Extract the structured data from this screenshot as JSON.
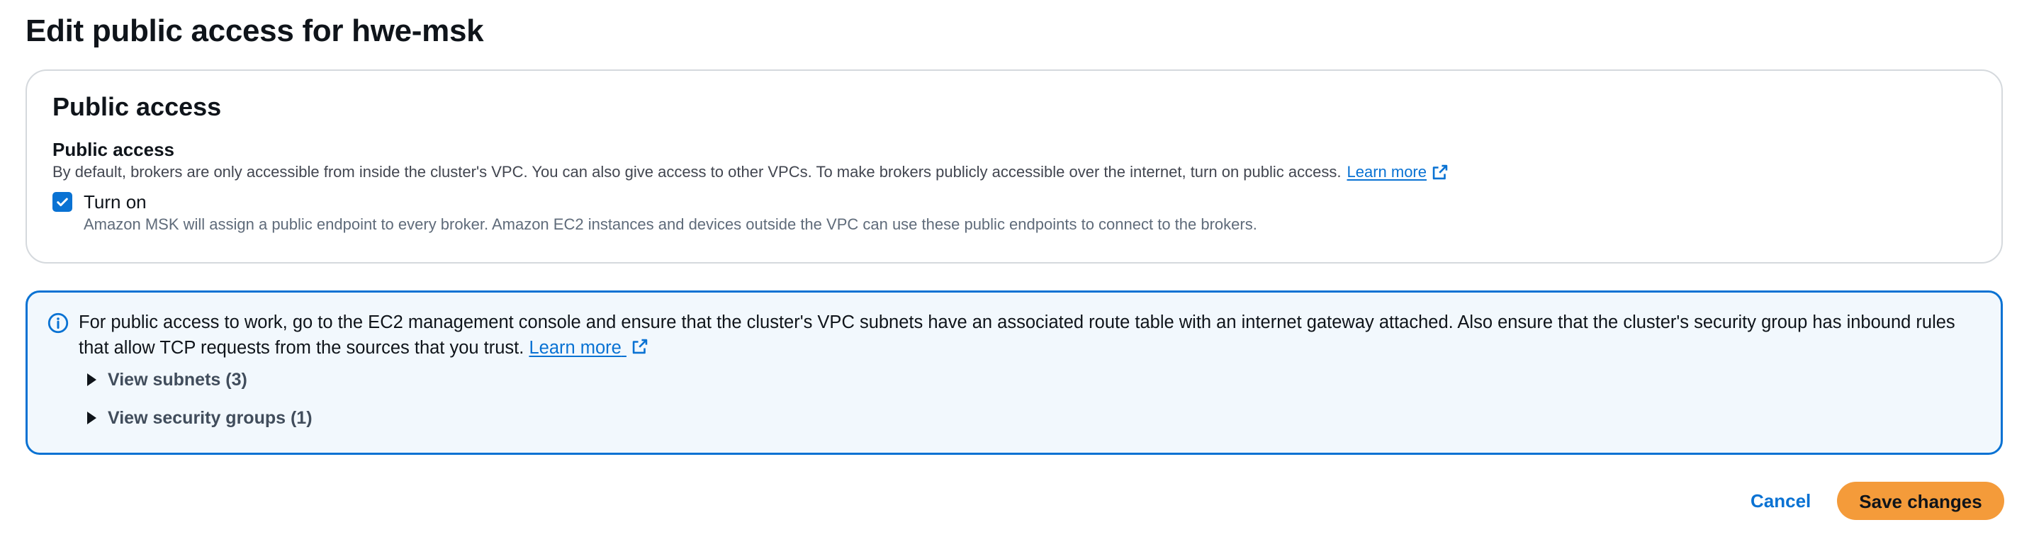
{
  "page": {
    "title": "Edit public access for hwe-msk"
  },
  "panel": {
    "heading": "Public access",
    "field_label": "Public access",
    "field_description": "By default, brokers are only accessible from inside the cluster's VPC. You can also give access to other VPCs. To make brokers publicly accessible over the internet, turn on public access.",
    "learn_more": "Learn more",
    "checkbox": {
      "label": "Turn on",
      "checked": true,
      "description": "Amazon MSK will assign a public endpoint to every broker. Amazon EC2 instances and devices outside the VPC can use these public endpoints to connect to the brokers."
    }
  },
  "info_alert": {
    "text": "For public access to work, go to the EC2 management console and ensure that the cluster's VPC subnets have an associated route table with an internet gateway attached. Also ensure that the cluster's security group has inbound rules that allow TCP requests from the sources that you trust.",
    "learn_more": "Learn more",
    "expanders": [
      {
        "label": "View subnets (3)"
      },
      {
        "label": "View security groups (1)"
      }
    ]
  },
  "footer": {
    "cancel_label": "Cancel",
    "save_label": "Save changes"
  },
  "colors": {
    "link": "#0972d3",
    "primary_button": "#f49b3a",
    "alert_border": "#0972d3",
    "alert_background": "#f2f8fd"
  },
  "icons": {
    "external_link": "external-link-icon",
    "info": "info-icon",
    "checkmark": "checkmark-icon",
    "caret_right": "caret-right-icon"
  }
}
